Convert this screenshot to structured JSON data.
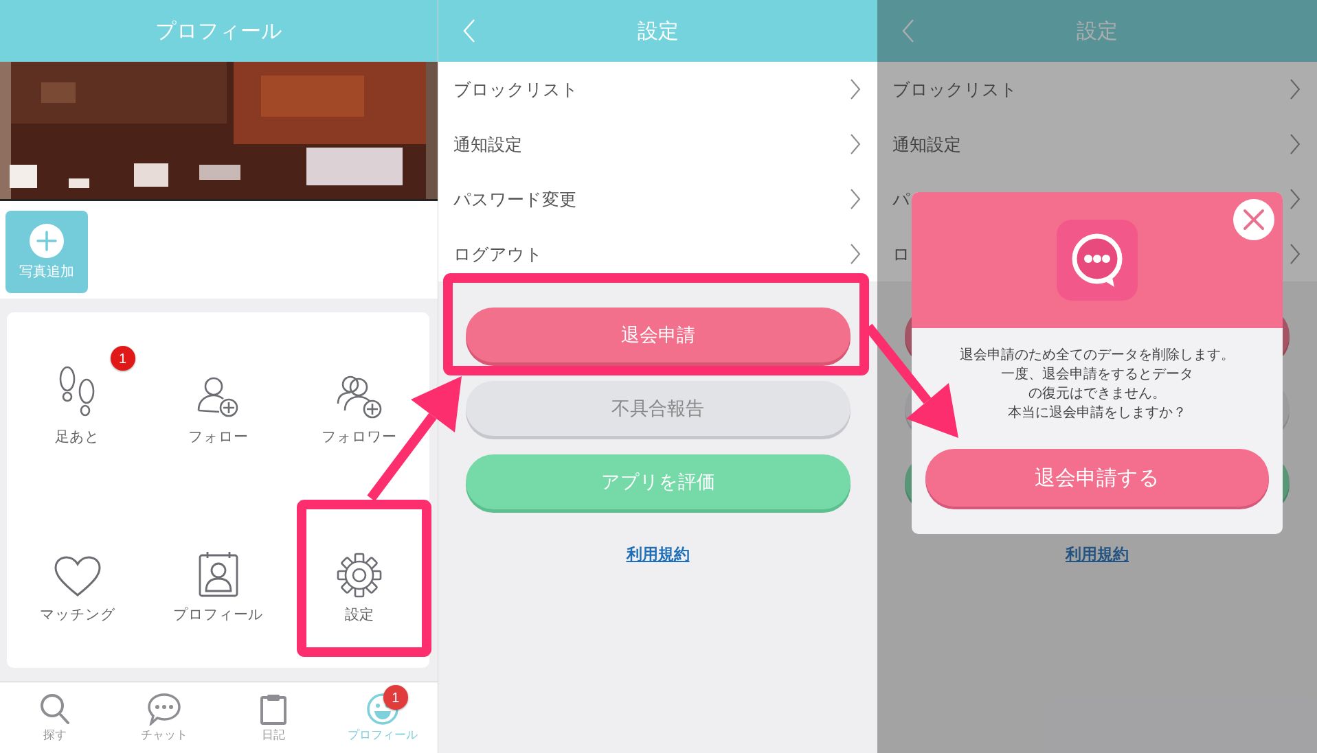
{
  "profile_screen": {
    "title": "プロフィール",
    "add_photo": "写真追加",
    "menu": [
      {
        "label": "足あと",
        "badge": "1"
      },
      {
        "label": "フォロー"
      },
      {
        "label": "フォロワー"
      },
      {
        "label": "マッチング"
      },
      {
        "label": "プロフィール"
      },
      {
        "label": "設定"
      }
    ],
    "tab_bar": [
      {
        "label": "探す",
        "selected": false
      },
      {
        "label": "チャット",
        "selected": false
      },
      {
        "label": "日記",
        "selected": false
      },
      {
        "label": "プロフィール",
        "selected": true,
        "badge": "1"
      }
    ]
  },
  "settings_screen": {
    "title": "設定",
    "rows": [
      "ブロックリスト",
      "通知設定",
      "パスワード変更",
      "ログアウト"
    ],
    "buttons": [
      {
        "label": "退会申請",
        "kind": "danger"
      },
      {
        "label": "不具合報告",
        "kind": "neutral"
      },
      {
        "label": "アプリを評価",
        "kind": "positive"
      }
    ],
    "link": "利用規約"
  },
  "confirm_screen": {
    "title": "設定",
    "rows": [
      "ブロックリスト",
      "通知設定",
      "パ",
      "ロ"
    ],
    "buttons": [
      {
        "kind": "danger"
      },
      {
        "kind": "neutral"
      },
      {
        "kind": "positive"
      }
    ],
    "link": "利用規約",
    "dialog": {
      "message": [
        "退会申請のため全てのデータを削除します。",
        "一度、退会申請をするとデータ",
        "の復元はできません。",
        "本当に退会申請をしますか？"
      ],
      "button": "退会申請する"
    }
  }
}
